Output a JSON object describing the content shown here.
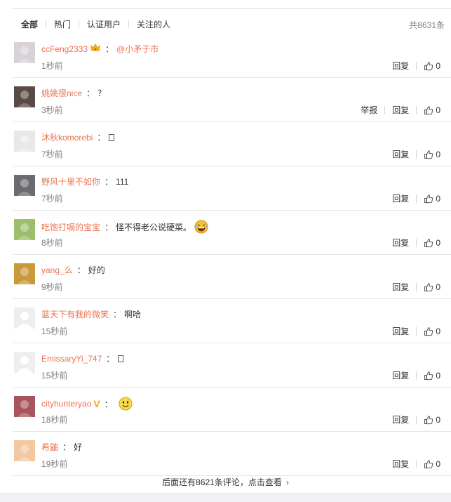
{
  "tabs": [
    "全部",
    "热门",
    "认证用户",
    "关注的人"
  ],
  "total": "共8631条",
  "actions": {
    "report": "举报",
    "reply": "回复"
  },
  "comments": [
    {
      "user": "ccFeng2333",
      "text": "",
      "mention": "@小矛于市",
      "time": "1秒前",
      "likes": "0",
      "avatar_color": "#d8d2d6",
      "badge": "crown"
    },
    {
      "user": "姚姚很nice",
      "text": "？",
      "mention": "",
      "time": "3秒前",
      "likes": "0",
      "avatar_color": "#5a4a44"
    },
    {
      "user": "沐秋komorebi",
      "text": "",
      "mention": "",
      "time": "7秒前",
      "likes": "0",
      "avatar_color": "#e8e8e8",
      "box": true
    },
    {
      "user": "野风十里不如你",
      "text": "111",
      "mention": "",
      "time": "7秒前",
      "likes": "0",
      "avatar_color": "#6a6a70"
    },
    {
      "user": "吃饱打嗝的宝宝",
      "text": "怪不得老公说硬菜。",
      "mention": "",
      "time": "8秒前",
      "likes": "0",
      "avatar_color": "#9bbf6a",
      "emoji": "laugh"
    },
    {
      "user": "yang_么",
      "text": "好的",
      "mention": "",
      "time": "9秒前",
      "likes": "0",
      "avatar_color": "#c89a3c"
    },
    {
      "user": "蓝天下有我的微笑",
      "text": "啊哈",
      "mention": "",
      "time": "15秒前",
      "likes": "0",
      "avatar_color": "#e6e6e6"
    },
    {
      "user": "EmissaryYi_747",
      "text": "",
      "mention": "",
      "time": "15秒前",
      "likes": "0",
      "avatar_color": "#e6e6e6",
      "box": true
    },
    {
      "user": "cityhunteryao",
      "text": "",
      "mention": "",
      "time": "18秒前",
      "likes": "0",
      "avatar_color": "#a8545c",
      "badge": "v",
      "emoji": "smile"
    },
    {
      "user": "希鼬",
      "text": "好",
      "mention": "",
      "time": "19秒前",
      "likes": "0",
      "avatar_color": "#f3c7a0"
    }
  ],
  "more_text": "后面还有8621条评论，点击查看",
  "colors": {
    "username": "#eb7350",
    "muted": "#808080",
    "v_badge": "#f5a623"
  }
}
